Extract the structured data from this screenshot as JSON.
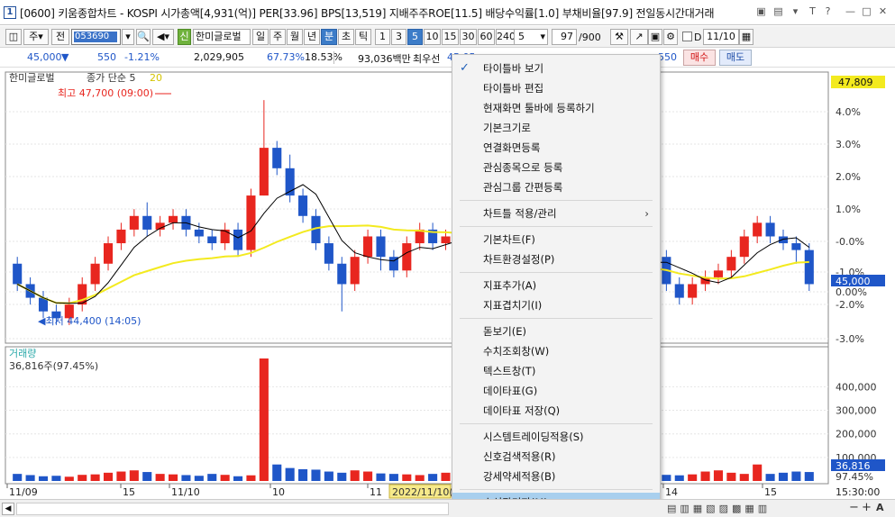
{
  "window": {
    "number": "1",
    "title": "[0600] 키움종합차트 - KOSPI 시가총액[4,931(억)] PER[33.96] BPS[13,519] 지배주주ROE[11.5] 배당수익률[1.0] 부채비율[97.9] 전일동시간대거래"
  },
  "toolbar1": {
    "mode": "주",
    "prev": "전",
    "code": "053690",
    "sin_badge": "신",
    "stock_name": "한미글로벌",
    "periods": [
      "일",
      "주",
      "월",
      "년",
      "분",
      "초",
      "틱"
    ],
    "selected_period": "분",
    "intervals": [
      "1",
      "3",
      "5",
      "10",
      "15",
      "30",
      "60",
      "240"
    ],
    "selected_interval": "5",
    "interval_value": "5",
    "count": "97",
    "count_total": "/900",
    "date_label": "D",
    "date": "11/10"
  },
  "quote": {
    "price": "45,000",
    "direction": "▼",
    "change": "550",
    "rate": "-1.21%",
    "volume": "2,029,905",
    "volume_ratio": "67.73%",
    "turnover": "18.53%",
    "amount": "93,036백만",
    "best_label": "최우선",
    "best_value": "45,05",
    "ask_value": "550",
    "buy_label": "매수",
    "sell_label": "매도"
  },
  "chart": {
    "legend_name": "한미글로벌",
    "legend_ma": "종가 단순 5",
    "legend_ma2": "20",
    "high_label": "최고 47,700 (09:00)",
    "low_label": "최저 44,400 (14:05)",
    "price_tag": "47,809",
    "current_tag": "45,000",
    "volume_title": "거래량",
    "volume_value": "36,816주(97.45%)",
    "volume_tag": "36,816",
    "volume_pct_tag": "97.45%",
    "date_tooltip": "2022/11/10(",
    "time_label": "15:30:00",
    "colors": {
      "up": "#e8261f",
      "down": "#1f56c8",
      "ma5": "#000000",
      "ma20": "#f3ea1f"
    }
  },
  "chart_data": {
    "type": "candlestick",
    "price_axis_ticks": [
      "4.0%",
      "3.0%",
      "2.0%",
      "1.0%",
      "-0.0%",
      "-1.0%",
      "0.00%",
      "-2.0%",
      "-3.0%"
    ],
    "volume_axis_ticks": [
      "400,000",
      "300,000",
      "200,000",
      "100,000"
    ],
    "x_labels_left": [
      "11/09",
      "15",
      "11/10",
      "10",
      "11"
    ],
    "x_labels_right": [
      "14",
      "15"
    ],
    "candles": [
      [
        45.3,
        45.0,
        44.9,
        45.4
      ],
      [
        45.0,
        44.8,
        44.7,
        45.1
      ],
      [
        44.8,
        44.6,
        44.5,
        44.9
      ],
      [
        44.6,
        44.5,
        44.4,
        44.7
      ],
      [
        44.5,
        44.7,
        44.4,
        44.8
      ],
      [
        44.7,
        45.0,
        44.6,
        45.1
      ],
      [
        45.0,
        45.3,
        44.9,
        45.4
      ],
      [
        45.3,
        45.6,
        45.2,
        45.7
      ],
      [
        45.6,
        45.8,
        45.5,
        45.9
      ],
      [
        45.8,
        46.0,
        45.7,
        46.1
      ],
      [
        46.0,
        45.8,
        45.7,
        46.2
      ],
      [
        45.8,
        45.9,
        45.7,
        46.0
      ],
      [
        45.9,
        46.0,
        45.8,
        46.1
      ],
      [
        46.0,
        45.8,
        45.7,
        46.1
      ],
      [
        45.8,
        45.7,
        45.6,
        45.9
      ],
      [
        45.7,
        45.6,
        45.5,
        45.8
      ],
      [
        45.6,
        45.8,
        45.5,
        45.9
      ],
      [
        45.8,
        45.5,
        45.4,
        45.9
      ],
      [
        45.5,
        46.3,
        45.4,
        46.4
      ],
      [
        46.3,
        47.0,
        46.3,
        47.7
      ],
      [
        47.0,
        46.7,
        46.6,
        47.1
      ],
      [
        46.7,
        46.3,
        46.2,
        46.9
      ],
      [
        46.3,
        46.0,
        45.9,
        46.4
      ],
      [
        46.0,
        45.6,
        45.5,
        46.1
      ],
      [
        45.6,
        45.3,
        45.2,
        45.7
      ],
      [
        45.3,
        45.0,
        44.6,
        45.4
      ],
      [
        45.0,
        45.4,
        44.9,
        45.5
      ],
      [
        45.4,
        45.7,
        45.3,
        45.8
      ],
      [
        45.7,
        45.4,
        45.2,
        45.8
      ],
      [
        45.4,
        45.2,
        45.1,
        45.5
      ],
      [
        45.2,
        45.6,
        45.1,
        45.7
      ],
      [
        45.6,
        45.8,
        45.5,
        45.9
      ],
      [
        45.8,
        45.6,
        45.5,
        45.9
      ],
      [
        45.6,
        45.7,
        45.5,
        45.8
      ],
      [
        45.7,
        45.5,
        45.4,
        45.8
      ],
      [
        45.5,
        45.3,
        45.2,
        45.6
      ],
      [
        45.3,
        45.1,
        45.0,
        45.4
      ],
      [
        45.1,
        44.9,
        44.8,
        45.2
      ],
      [
        44.9,
        44.7,
        44.6,
        45.0
      ],
      [
        44.7,
        44.5,
        44.4,
        44.8
      ],
      [
        44.5,
        44.6,
        44.4,
        44.7
      ],
      [
        44.6,
        44.8,
        44.5,
        44.9
      ],
      [
        44.8,
        45.0,
        44.7,
        45.1
      ],
      [
        45.0,
        45.8,
        44.9,
        45.9
      ],
      [
        45.8,
        45.2,
        45.1,
        46.1
      ],
      [
        45.2,
        45.0,
        44.9,
        45.3
      ],
      [
        45.0,
        45.2,
        44.9,
        45.3
      ],
      [
        45.2,
        45.4,
        45.1,
        45.5
      ],
      [
        45.4,
        45.6,
        45.3,
        45.7
      ],
      [
        45.6,
        45.4,
        45.3,
        45.8
      ],
      [
        45.4,
        45.0,
        44.9,
        45.5
      ],
      [
        45.0,
        44.8,
        44.7,
        45.1
      ],
      [
        44.8,
        45.0,
        44.7,
        45.1
      ],
      [
        45.0,
        45.1,
        44.9,
        45.2
      ],
      [
        45.1,
        45.2,
        45.0,
        45.3
      ],
      [
        45.2,
        45.4,
        45.1,
        45.5
      ],
      [
        45.4,
        45.7,
        45.3,
        45.8
      ],
      [
        45.7,
        45.9,
        45.6,
        46.0
      ],
      [
        45.9,
        45.7,
        45.6,
        46.0
      ],
      [
        45.7,
        45.6,
        45.5,
        45.8
      ],
      [
        45.6,
        45.5,
        45.3,
        45.7
      ],
      [
        45.5,
        45.0,
        44.9,
        45.6
      ]
    ],
    "volumes": [
      30,
      25,
      20,
      22,
      18,
      26,
      28,
      35,
      40,
      45,
      38,
      30,
      28,
      25,
      22,
      30,
      26,
      20,
      24,
      520,
      70,
      55,
      50,
      48,
      40,
      35,
      45,
      40,
      32,
      30,
      28,
      25,
      30,
      35,
      28,
      30,
      26,
      24,
      28,
      30,
      35,
      32,
      30,
      95,
      60,
      40,
      35,
      30,
      28,
      30,
      26,
      24,
      28,
      40,
      45,
      35,
      30,
      70,
      30,
      35,
      40,
      38
    ]
  }
}
